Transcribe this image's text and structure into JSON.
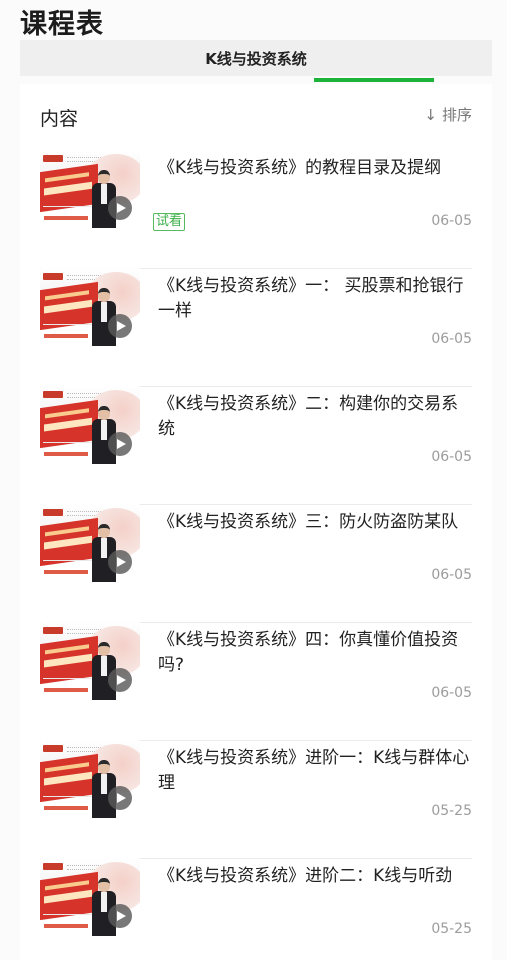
{
  "page": {
    "title": "课程表"
  },
  "tab": {
    "label": "K线与投资系统",
    "accent_color": "#1db23a"
  },
  "content": {
    "section_title": "内容",
    "sort_icon": "↓",
    "sort_label": "排序"
  },
  "items": [
    {
      "title": "《K线与投资系统》的教程目录及提纲",
      "badge": "试看",
      "date": "06-05",
      "thumb_icon": "play-icon"
    },
    {
      "title": "《K线与投资系统》一： 买股票和抢银行一样",
      "date": "06-05",
      "thumb_icon": "play-icon"
    },
    {
      "title": "《K线与投资系统》二：构建你的交易系统",
      "date": "06-05",
      "thumb_icon": "play-icon"
    },
    {
      "title": "《K线与投资系统》三：防火防盗防某队",
      "date": "06-05",
      "thumb_icon": "play-icon"
    },
    {
      "title": "《K线与投资系统》四：你真懂价值投资吗?",
      "date": "06-05",
      "thumb_icon": "play-icon"
    },
    {
      "title": "《K线与投资系统》进阶一：K线与群体心理",
      "date": "05-25",
      "thumb_icon": "play-icon"
    },
    {
      "title": "《K线与投资系统》进阶二：K线与听劲",
      "date": "05-25",
      "thumb_icon": "play-icon"
    }
  ]
}
